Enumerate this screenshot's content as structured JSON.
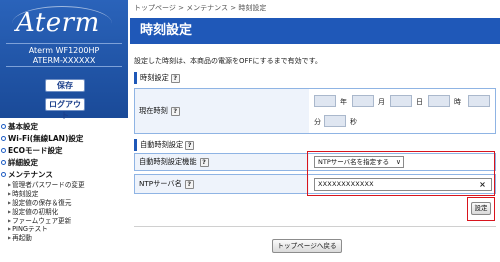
{
  "sidebar": {
    "logo": "Aterm",
    "model_line1": "Aterm WF1200HP",
    "model_line2": "ATERM-XXXXXX",
    "save_label": "保存",
    "logout_label": "ログアウト",
    "menu": [
      {
        "label": "基本設定"
      },
      {
        "label": "Wi-Fi(無線LAN)設定"
      },
      {
        "label": "ECOモード設定"
      },
      {
        "label": "詳細設定"
      },
      {
        "label": "メンテナンス"
      }
    ],
    "maintenance_items": [
      {
        "label": "管理者パスワードの変更"
      },
      {
        "label": "時刻設定"
      },
      {
        "label": "設定値の保存＆復元"
      },
      {
        "label": "設定値の初期化"
      },
      {
        "label": "ファームウェア更新"
      },
      {
        "label": "PINGテスト"
      },
      {
        "label": "再起動"
      }
    ]
  },
  "breadcrumb": "トップページ > メンテナンス > 時刻設定",
  "page_title": "時刻設定",
  "description": "設定した時刻は、本商品の電源をOFFにするまで有効です。",
  "time_section": {
    "heading": "時刻設定",
    "current_time_label": "現在時刻",
    "fields": [
      {
        "value": "",
        "unit": "年"
      },
      {
        "value": "",
        "unit": "月"
      },
      {
        "value": "",
        "unit": "日"
      },
      {
        "value": "",
        "unit": "時"
      },
      {
        "value": "",
        "unit": "分"
      },
      {
        "value": "",
        "unit": "秒"
      }
    ]
  },
  "auto_section": {
    "heading": "自動時刻設定",
    "function_label": "自動時刻設定機能",
    "function_value": "NTPサーバ名を指定する",
    "ntp_label": "NTPサーバ名",
    "ntp_value": "XXXXXXXXXXXX"
  },
  "help_glyph": "?",
  "clear_glyph": "×",
  "select_arrow": "∨",
  "set_button": "設定",
  "back_button": "トップページへ戻る",
  "colors": {
    "accent": "#1f58b8",
    "highlight": "#d8141d"
  }
}
